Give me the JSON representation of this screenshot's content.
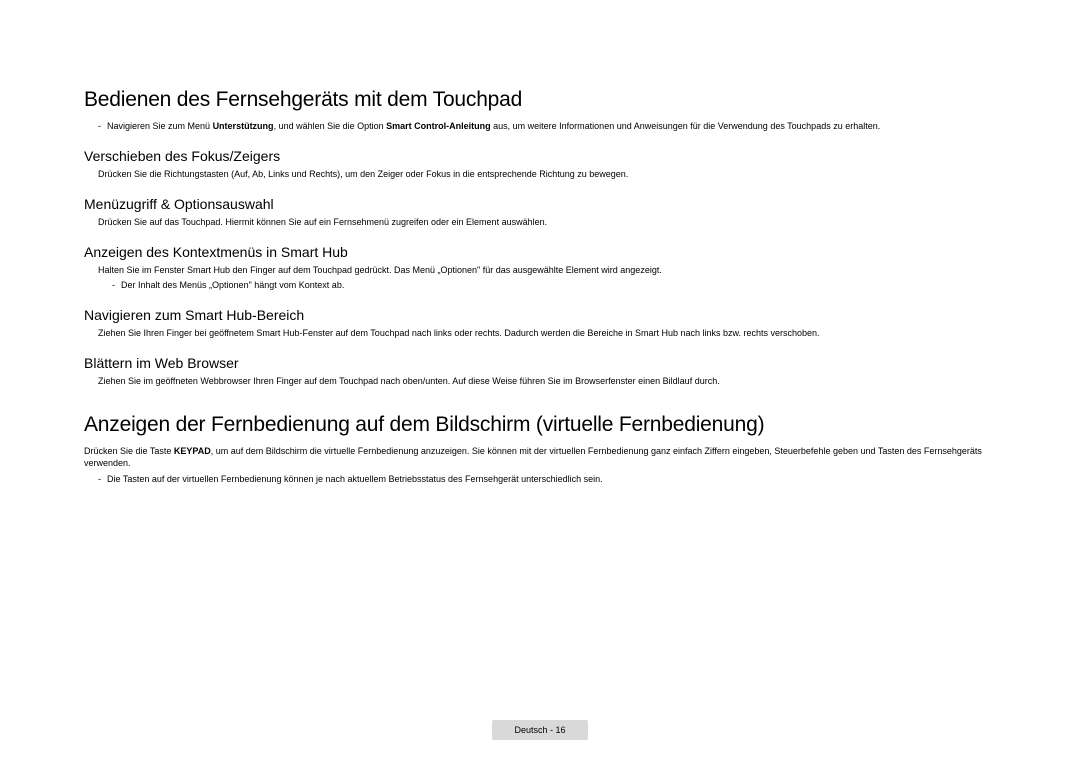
{
  "title1": "Bedienen des Fernsehgeräts mit dem Touchpad",
  "intro1_pre": "Navigieren Sie zum Menü ",
  "intro1_b1": "Unterstützung",
  "intro1_mid": ", und wählen Sie die Option ",
  "intro1_b2": "Smart Control-Anleitung",
  "intro1_post": " aus, um weitere Informationen und Anweisungen für die Verwendung des Touchpads zu erhalten.",
  "s1_h": "Verschieben des Fokus/Zeigers",
  "s1_p": "Drücken Sie die Richtungstasten (Auf, Ab, Links und Rechts), um den Zeiger oder Fokus in die entsprechende Richtung zu bewegen.",
  "s2_h": "Menüzugriff & Optionsauswahl",
  "s2_p": "Drücken Sie auf das Touchpad. Hiermit können Sie auf ein Fernsehmenü zugreifen oder ein Element auswählen.",
  "s3_h": "Anzeigen des Kontextmenüs in Smart Hub",
  "s3_p": "Halten Sie im Fenster Smart Hub den Finger auf dem Touchpad gedrückt. Das Menü „Optionen\" für das ausgewählte Element wird angezeigt.",
  "s3_sub": "Der Inhalt des Menüs „Optionen\" hängt vom Kontext ab.",
  "s4_h": "Navigieren zum Smart Hub-Bereich",
  "s4_p": "Ziehen Sie Ihren Finger bei geöffnetem Smart Hub-Fenster auf dem Touchpad nach links oder rechts. Dadurch werden die Bereiche in Smart Hub nach links bzw. rechts verschoben.",
  "s5_h": "Blättern im  Web Browser",
  "s5_p": "Ziehen Sie im geöffneten Webbrowser Ihren Finger auf dem Touchpad nach oben/unten. Auf diese Weise führen Sie im Browserfenster einen Bildlauf durch.",
  "title2": "Anzeigen der Fernbedienung auf dem Bildschirm (virtuelle Fernbedienung)",
  "p2_pre": "Drücken Sie die Taste ",
  "p2_b": "KEYPAD",
  "p2_post": ", um auf dem Bildschirm die virtuelle Fernbedienung anzuzeigen. Sie können mit der virtuellen Fernbedienung ganz einfach Ziffern eingeben, Steuerbefehle geben und Tasten des Fernsehgeräts verwenden.",
  "p2_sub": "Die Tasten auf der virtuellen Fernbedienung können je nach aktuellem Betriebsstatus des Fernsehgerät unterschiedlich sein.",
  "footer": "Deutsch - 16"
}
